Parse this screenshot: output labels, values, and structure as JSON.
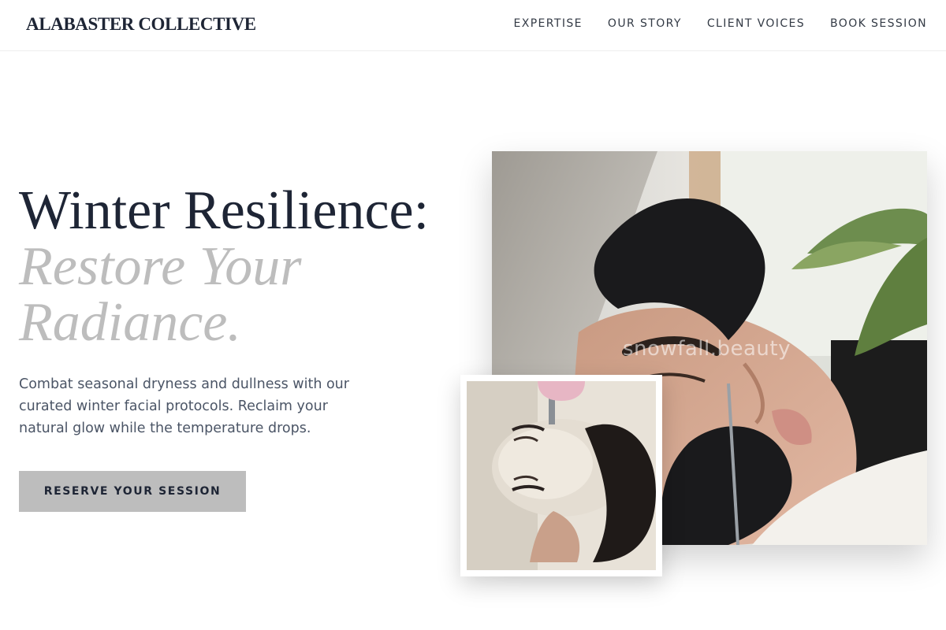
{
  "header": {
    "brand": "ALABASTER COLLECTIVE",
    "nav": [
      {
        "label": "EXPERTISE"
      },
      {
        "label": "OUR STORY"
      },
      {
        "label": "CLIENT VOICES"
      },
      {
        "label": "BOOK SESSION"
      }
    ]
  },
  "hero": {
    "headline_main": "Winter Resilience:",
    "headline_accent_1": "Restore Your",
    "headline_accent_2": "Radiance.",
    "lede": "Combat seasonal dryness and dullness with our curated winter facial protocols. Reclaim your natural glow while the temperature drops.",
    "cta_label": "RESERVE YOUR SESSION"
  },
  "media": {
    "main_photo": "facial-extraction-photo",
    "inset_photo": "facial-mask-photo",
    "watermark": "snowfall.beauty"
  },
  "colors": {
    "ink": "#1e2535",
    "accent_gray": "#bdbdbd",
    "body_text": "#4b5566"
  }
}
